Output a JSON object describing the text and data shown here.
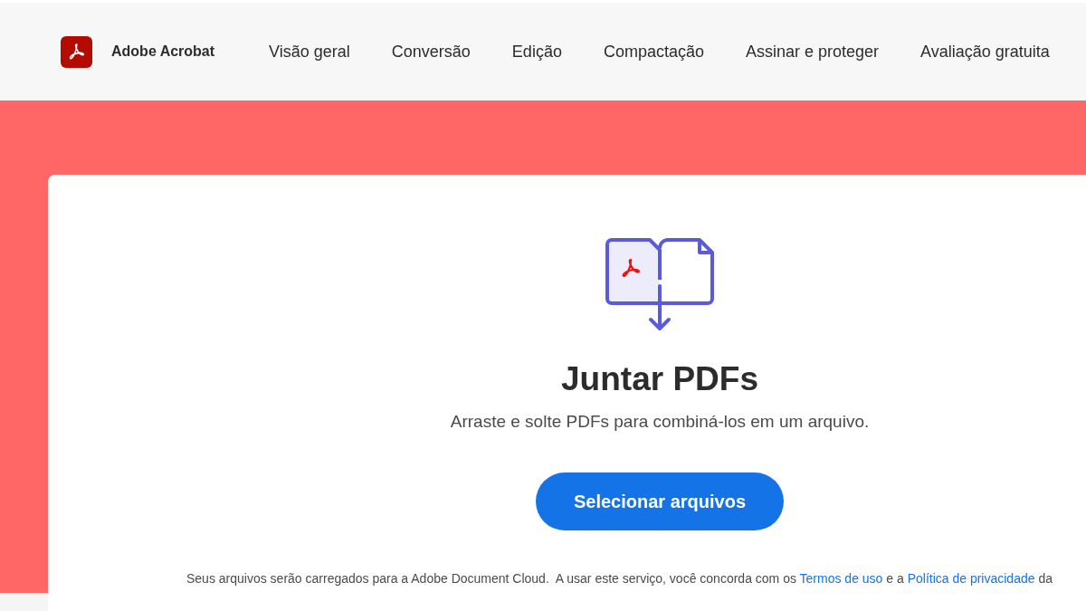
{
  "header": {
    "brand": "Adobe Acrobat",
    "nav": [
      {
        "label": "Visão geral"
      },
      {
        "label": "Conversão"
      },
      {
        "label": "Edição"
      },
      {
        "label": "Compactação"
      },
      {
        "label": "Assinar e proteger"
      },
      {
        "label": "Avaliação gratuita"
      }
    ]
  },
  "tool": {
    "title": "Juntar PDFs",
    "subtitle": "Arraste e solte PDFs para combiná-los em um arquivo.",
    "button": "Selecionar arquivos"
  },
  "notice": [
    {
      "kind": "text",
      "text": "Seus arquivos serão carregados para a Adobe Document Cloud.  A usar este serviço, você concorda com os"
    },
    {
      "kind": "link",
      "text": "Termos de uso"
    },
    {
      "kind": "text",
      "text": "e a"
    },
    {
      "kind": "link",
      "text": "Política de privacidade"
    },
    {
      "kind": "text",
      "text": "da"
    }
  ]
}
